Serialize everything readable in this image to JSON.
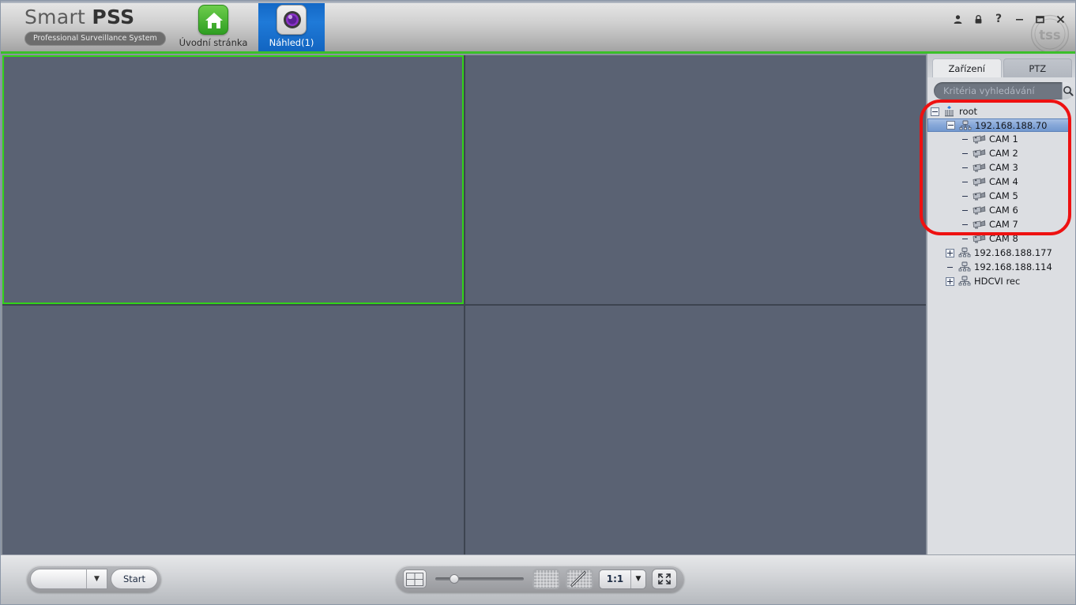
{
  "app": {
    "brand_title_light": "Smart ",
    "brand_title_bold": "PSS",
    "brand_subtitle": "Professional Surveillance System",
    "watermark_text": "tss"
  },
  "nav": {
    "tabs": [
      {
        "label": "Úvodní stránka",
        "icon": "home-icon",
        "active": false
      },
      {
        "label": "Náhled(1)",
        "icon": "preview-camera-icon",
        "active": true
      }
    ]
  },
  "titlebar": {
    "buttons": [
      {
        "name": "user-icon",
        "glyph": "♟"
      },
      {
        "name": "lock-icon",
        "glyph": "⚿"
      },
      {
        "name": "help-icon",
        "glyph": "?"
      },
      {
        "name": "minimize-icon",
        "glyph": "─"
      },
      {
        "name": "maximize-icon",
        "glyph": "□"
      },
      {
        "name": "close-icon",
        "glyph": "✕"
      }
    ]
  },
  "video": {
    "layout": "2x2",
    "cells": [
      {
        "index": 1,
        "selected": true
      },
      {
        "index": 2,
        "selected": false
      },
      {
        "index": 3,
        "selected": false
      },
      {
        "index": 4,
        "selected": false
      }
    ],
    "panel_color": "#5a6273",
    "selection_color": "#32d21a"
  },
  "right_panel": {
    "tabs": [
      {
        "label": "Zařízení",
        "active": true
      },
      {
        "label": "PTZ",
        "active": false
      }
    ],
    "search": {
      "placeholder": "Kritéria vyhledávání",
      "value": "",
      "icon": "search-icon"
    },
    "tree": [
      {
        "label": "root",
        "depth": 0,
        "expander": "minus",
        "icon": "root-group-icon",
        "selected": false
      },
      {
        "label": "192.168.188.70",
        "depth": 1,
        "expander": "minus",
        "icon": "device-icon",
        "selected": true
      },
      {
        "label": "CAM 1",
        "depth": 2,
        "expander": "none",
        "icon": "camera-icon",
        "selected": false
      },
      {
        "label": "CAM 2",
        "depth": 2,
        "expander": "none",
        "icon": "camera-icon",
        "selected": false
      },
      {
        "label": "CAM 3",
        "depth": 2,
        "expander": "none",
        "icon": "camera-icon",
        "selected": false
      },
      {
        "label": "CAM 4",
        "depth": 2,
        "expander": "none",
        "icon": "camera-icon",
        "selected": false
      },
      {
        "label": "CAM 5",
        "depth": 2,
        "expander": "none",
        "icon": "camera-icon",
        "selected": false
      },
      {
        "label": "CAM 6",
        "depth": 2,
        "expander": "none",
        "icon": "camera-icon",
        "selected": false
      },
      {
        "label": "CAM 7",
        "depth": 2,
        "expander": "none",
        "icon": "camera-icon",
        "selected": false
      },
      {
        "label": "CAM 8",
        "depth": 2,
        "expander": "none",
        "icon": "camera-icon",
        "selected": false
      },
      {
        "label": "192.168.188.177",
        "depth": 1,
        "expander": "plus",
        "icon": "device-icon",
        "selected": false
      },
      {
        "label": "192.168.188.114",
        "depth": 1,
        "expander": "none",
        "icon": "device-icon",
        "selected": false
      },
      {
        "label": "HDCVI rec",
        "depth": 1,
        "expander": "plus",
        "icon": "device-icon",
        "selected": false
      }
    ],
    "annotation": {
      "shape": "rounded-rectangle",
      "color": "#ee1111"
    }
  },
  "bottom_bar": {
    "tour_combo": {
      "value": "",
      "arrow_icon": "chevron-down-icon"
    },
    "start_button": {
      "label": "Start"
    },
    "layout_button": {
      "icon": "split-2x2-icon"
    },
    "volume_slider": {
      "value": 12,
      "min": 0,
      "max": 100
    },
    "grid_button": {
      "icon": "grid-icon"
    },
    "draw_grid_button": {
      "icon": "grid-pencil-icon"
    },
    "zoom_select": {
      "value": "1:1",
      "arrow_icon": "chevron-down-icon"
    },
    "fullscreen_button": {
      "icon": "fullscreen-icon"
    }
  }
}
